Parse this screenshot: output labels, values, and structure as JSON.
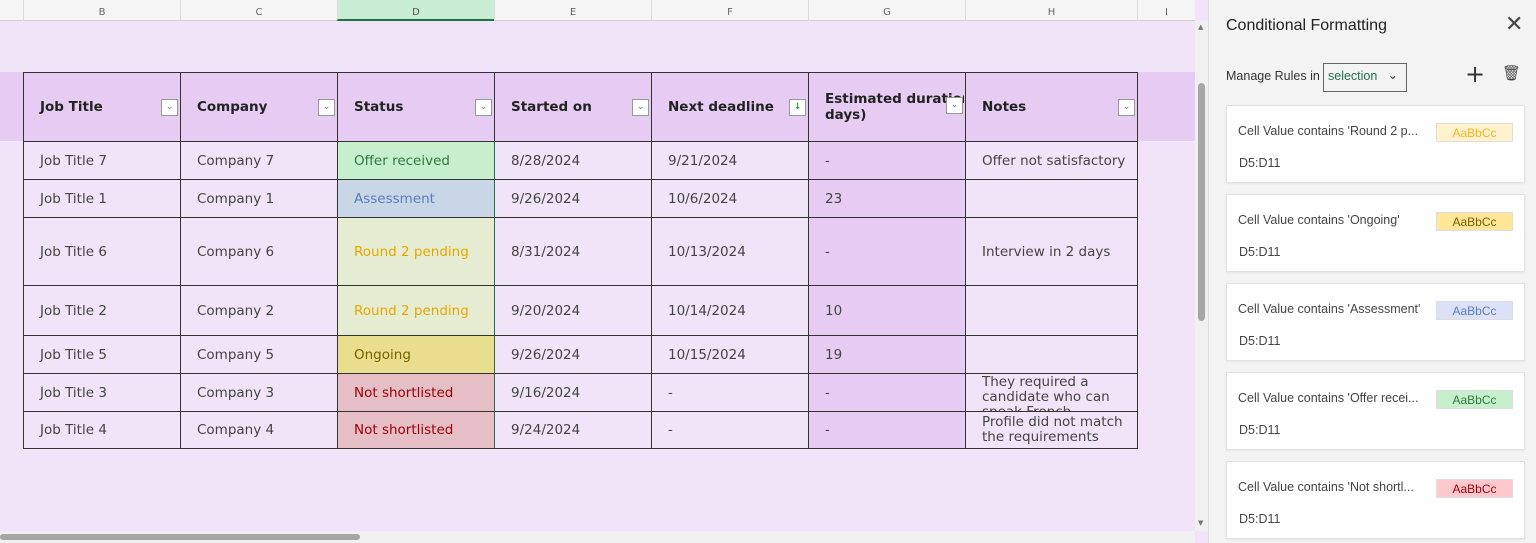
{
  "columns": [
    "B",
    "C",
    "D",
    "E",
    "F",
    "G",
    "H",
    "I"
  ],
  "headers": [
    "Job Title",
    "Company",
    "Status",
    "Started on",
    "Next deadline",
    "Estimated duration (in days)",
    "Notes"
  ],
  "header_g_line1": "Estimated duratio",
  "header_g_line2": "(in days)",
  "rows": [
    {
      "job": "Job Title 7",
      "company": "Company 7",
      "status": "Offer received",
      "started": "8/28/2024",
      "deadline": "9/21/2024",
      "duration": "-",
      "notes": "Offer not satisfactory"
    },
    {
      "job": "Job Title 1",
      "company": "Company 1",
      "status": "Assessment",
      "started": "9/26/2024",
      "deadline": "10/6/2024",
      "duration": "23",
      "notes": ""
    },
    {
      "job": "Job Title 6",
      "company": "Company 6",
      "status": "Round 2 pending",
      "started": "8/31/2024",
      "deadline": "10/13/2024",
      "duration": "-",
      "notes": "Interview in 2 days"
    },
    {
      "job": "Job Title 2",
      "company": "Company 2",
      "status": "Round 2 pending",
      "started": "9/20/2024",
      "deadline": "10/14/2024",
      "duration": "10",
      "notes": ""
    },
    {
      "job": "Job Title 5",
      "company": "Company 5",
      "status": "Ongoing",
      "started": "9/26/2024",
      "deadline": "10/15/2024",
      "duration": "19",
      "notes": ""
    },
    {
      "job": "Job Title 3",
      "company": "Company 3",
      "status": "Not shortlisted",
      "started": "9/16/2024",
      "deadline": "-",
      "duration": "-",
      "notes": "They required a candidate who can speak French"
    },
    {
      "job": "Job Title 4",
      "company": "Company 4",
      "status": "Not shortlisted",
      "started": "9/24/2024",
      "deadline": "-",
      "duration": "-",
      "notes": "Profile did not match the requirements"
    }
  ],
  "status_colors": {
    "Offer received": {
      "bg": "#c6efce",
      "fg": "#2f7a3a"
    },
    "Assessment": {
      "bg": "#c9d6e6",
      "fg": "#5a7cc0"
    },
    "Round 2 pending": {
      "bg": "#e5ecd2",
      "fg": "#e6a800"
    },
    "Ongoing": {
      "bg": "#e8de8e",
      "fg": "#7a6000"
    },
    "Not shortlisted": {
      "bg": "#e6bec6",
      "fg": "#9c0006"
    }
  },
  "panel": {
    "title": "Conditional Formatting",
    "manage_label": "Manage Rules in",
    "manage_value": "selection",
    "rules": [
      {
        "text": "Cell Value contains 'Round 2 p...",
        "range": "D5:D11",
        "preview": "AaBbCc",
        "bg": "#fff2cc",
        "fg": "#f0b429"
      },
      {
        "text": "Cell Value contains 'Ongoing'",
        "range": "D5:D11",
        "preview": "AaBbCc",
        "bg": "#ffe699",
        "fg": "#7a6000"
      },
      {
        "text": "Cell Value contains 'Assessment'",
        "range": "D5:D11",
        "preview": "AaBbCc",
        "bg": "#dde1f7",
        "fg": "#5a7cc0"
      },
      {
        "text": "Cell Value contains 'Offer recei...",
        "range": "D5:D11",
        "preview": "AaBbCc",
        "bg": "#c6efce",
        "fg": "#2f7a3a"
      },
      {
        "text": "Cell Value contains 'Not shortl...",
        "range": "D5:D11",
        "preview": "AaBbCc",
        "bg": "#ffc7ce",
        "fg": "#9c0006"
      }
    ]
  }
}
